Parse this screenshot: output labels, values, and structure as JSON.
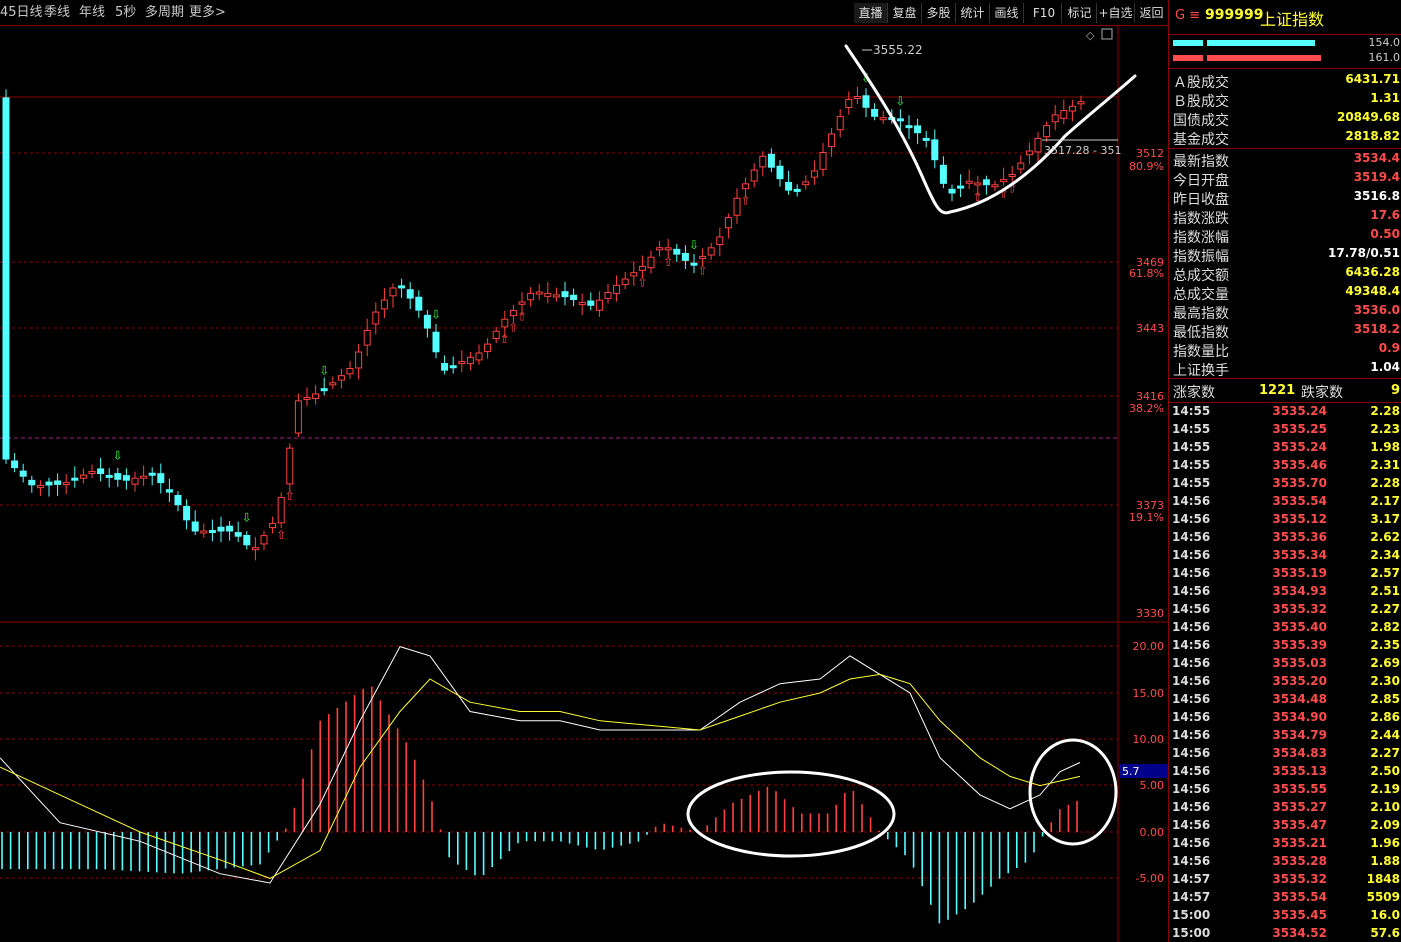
{
  "period_tabs": [
    "45日线",
    "季线",
    "年线",
    "5秒",
    "多周期",
    "更多>"
  ],
  "toolbar": [
    "直播",
    "复盘",
    "多股",
    "统计",
    "画线",
    "F10",
    "标记",
    "+自选",
    "返回"
  ],
  "chart": {
    "price_top": "3555.22",
    "tooltip": "3517.28 - 351",
    "price_labels": [
      {
        "price": "3512",
        "pct": "80.9%"
      },
      {
        "price": "3469",
        "pct": "61.8%"
      },
      {
        "price": "3443",
        "pct": ""
      },
      {
        "price": "3416",
        "pct": "38.2%"
      },
      {
        "price": "3373",
        "pct": "19.1%"
      },
      {
        "price": "3330",
        "pct": ""
      }
    ],
    "macd_labels": [
      "20.00",
      "15.00",
      "10.00",
      "5.00",
      "0.00",
      "-5.00"
    ],
    "macd_badge": "5.7",
    "colors": {
      "up": "#ff4040",
      "down": "#54ffff",
      "dif": "#ffffff",
      "dea": "#ffff33",
      "grid": "#8a0000"
    }
  },
  "right_panel": {
    "title_prefix": "G ≡",
    "code": "999999",
    "name": "上证指数",
    "bar1_val": "154.0",
    "bar2_val": "161.0",
    "stats": [
      {
        "label": "Ａ股成交",
        "value": "6431.71"
      },
      {
        "label": "Ｂ股成交",
        "value": "1.31"
      },
      {
        "label": "国债成交",
        "value": "20849.68"
      },
      {
        "label": "基金成交",
        "value": "2818.82"
      },
      {
        "label": "最新指数",
        "value": "3534.4"
      },
      {
        "label": "今日开盘",
        "value": "3519.4"
      },
      {
        "label": "昨日收盘",
        "value": "3516.8"
      },
      {
        "label": "指数涨跌",
        "value": "17.6"
      },
      {
        "label": "指数涨幅",
        "value": "0.50"
      },
      {
        "label": "指数振幅",
        "value": "17.78/0.51"
      },
      {
        "label": "总成交额",
        "value": "6436.28"
      },
      {
        "label": "总成交量",
        "value": "49348.4"
      },
      {
        "label": "最高指数",
        "value": "3536.0"
      },
      {
        "label": "最低指数",
        "value": "3518.2"
      },
      {
        "label": "指数量比",
        "value": "0.9"
      },
      {
        "label": "上证换手",
        "value": "1.04"
      }
    ],
    "breadth": {
      "up_label": "涨家数",
      "up_value": "1221",
      "down_label": "跌家数",
      "down_value": "9"
    },
    "ticks": [
      {
        "time": "14:55",
        "price": "3535.24",
        "vol": "2.28"
      },
      {
        "time": "14:55",
        "price": "3535.25",
        "vol": "2.23"
      },
      {
        "time": "14:55",
        "price": "3535.24",
        "vol": "1.98"
      },
      {
        "time": "14:55",
        "price": "3535.46",
        "vol": "2.31"
      },
      {
        "time": "14:55",
        "price": "3535.70",
        "vol": "2.28"
      },
      {
        "time": "14:56",
        "price": "3535.54",
        "vol": "2.17"
      },
      {
        "time": "14:56",
        "price": "3535.12",
        "vol": "3.17"
      },
      {
        "time": "14:56",
        "price": "3535.36",
        "vol": "2.62"
      },
      {
        "time": "14:56",
        "price": "3535.34",
        "vol": "2.34"
      },
      {
        "time": "14:56",
        "price": "3535.19",
        "vol": "2.57"
      },
      {
        "time": "14:56",
        "price": "3534.93",
        "vol": "2.51"
      },
      {
        "time": "14:56",
        "price": "3535.32",
        "vol": "2.27"
      },
      {
        "time": "14:56",
        "price": "3535.40",
        "vol": "2.82"
      },
      {
        "time": "14:56",
        "price": "3535.39",
        "vol": "2.35"
      },
      {
        "time": "14:56",
        "price": "3535.03",
        "vol": "2.69"
      },
      {
        "time": "14:56",
        "price": "3535.20",
        "vol": "2.30"
      },
      {
        "time": "14:56",
        "price": "3534.48",
        "vol": "2.85"
      },
      {
        "time": "14:56",
        "price": "3534.90",
        "vol": "2.86"
      },
      {
        "time": "14:56",
        "price": "3534.79",
        "vol": "2.44"
      },
      {
        "time": "14:56",
        "price": "3534.83",
        "vol": "2.27"
      },
      {
        "time": "14:56",
        "price": "3535.13",
        "vol": "2.50"
      },
      {
        "time": "14:56",
        "price": "3535.55",
        "vol": "2.19"
      },
      {
        "time": "14:56",
        "price": "3535.27",
        "vol": "2.10"
      },
      {
        "time": "14:56",
        "price": "3535.47",
        "vol": "2.09"
      },
      {
        "time": "14:56",
        "price": "3535.21",
        "vol": "1.96"
      },
      {
        "time": "14:56",
        "price": "3535.28",
        "vol": "1.88"
      },
      {
        "time": "14:57",
        "price": "3535.32",
        "vol": "1848"
      },
      {
        "time": "14:57",
        "price": "3535.54",
        "vol": "5509"
      },
      {
        "time": "15:00",
        "price": "3535.45",
        "vol": "16.0"
      },
      {
        "time": "15:00",
        "price": "3534.52",
        "vol": "57.6"
      }
    ]
  }
}
